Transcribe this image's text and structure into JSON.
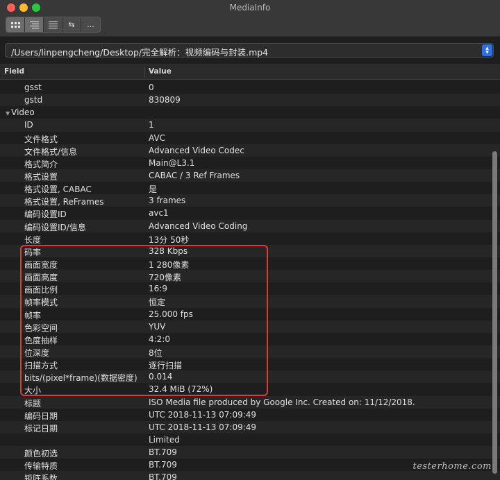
{
  "window": {
    "title": "MediaInfo"
  },
  "toolbar": {
    "segments": [
      "grid",
      "list-detail",
      "list",
      "⇆",
      "..."
    ]
  },
  "path": {
    "value": "/Users/linpengcheng/Desktop/完全解析：视频编码与封装.mp4"
  },
  "table": {
    "headers": {
      "field": "Field",
      "value": "Value"
    },
    "rows": [
      {
        "field": "gsst",
        "value": "0"
      },
      {
        "field": "gstd",
        "value": "830809"
      },
      {
        "field": "Video",
        "value": "",
        "section": true
      },
      {
        "field": "ID",
        "value": "1"
      },
      {
        "field": "文件格式",
        "value": "AVC"
      },
      {
        "field": "文件格式/信息",
        "value": "Advanced Video Codec"
      },
      {
        "field": "格式简介",
        "value": "Main@L3.1"
      },
      {
        "field": "格式设置",
        "value": "CABAC / 3 Ref Frames"
      },
      {
        "field": "格式设置, CABAC",
        "value": "是"
      },
      {
        "field": "格式设置, ReFrames",
        "value": "3 frames"
      },
      {
        "field": "编码设置ID",
        "value": "avc1"
      },
      {
        "field": "编码设置ID/信息",
        "value": "Advanced Video Coding"
      },
      {
        "field": "长度",
        "value": "13分 50秒"
      },
      {
        "field": "码率",
        "value": "328 Kbps"
      },
      {
        "field": "画面宽度",
        "value": "1 280像素"
      },
      {
        "field": "画面高度",
        "value": "720像素"
      },
      {
        "field": "画面比例",
        "value": "16:9"
      },
      {
        "field": "帧率模式",
        "value": "恒定"
      },
      {
        "field": "帧率",
        "value": "25.000 fps"
      },
      {
        "field": "色彩空间",
        "value": "YUV"
      },
      {
        "field": "色度抽样",
        "value": "4:2:0"
      },
      {
        "field": "位深度",
        "value": "8位"
      },
      {
        "field": "扫描方式",
        "value": "逐行扫描"
      },
      {
        "field": "bits/(pixel*frame)(数据密度)",
        "value": "0.014"
      },
      {
        "field": "大小",
        "value": "32.4 MiB (72%)"
      },
      {
        "field": "标题",
        "value": "ISO Media file produced by Google Inc. Created on: 11/12/2018."
      },
      {
        "field": "编码日期",
        "value": "UTC 2018-11-13 07:09:49"
      },
      {
        "field": "标记日期",
        "value": "UTC 2018-11-13 07:09:49"
      },
      {
        "field": "",
        "value": "Limited"
      },
      {
        "field": "颜色初选",
        "value": "BT.709"
      },
      {
        "field": "传输特质",
        "value": "BT.709"
      },
      {
        "field": "矩阵系数",
        "value": "BT.709"
      }
    ]
  },
  "watermark": "testerhome.com",
  "colors": {
    "highlight": "#e03a36",
    "accent": "#2f6fe0"
  }
}
